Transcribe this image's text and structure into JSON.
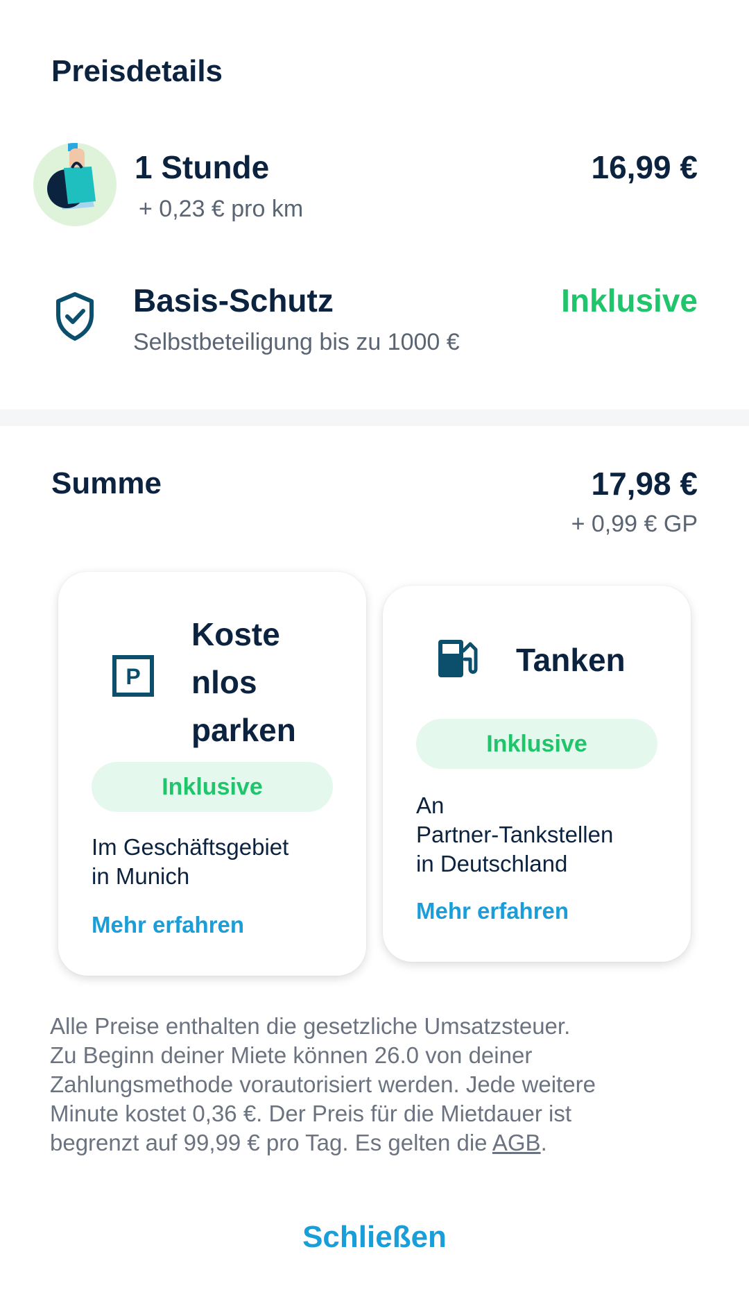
{
  "header": {
    "title": "Preisdetails"
  },
  "rental": {
    "title": "1 Stunde",
    "per_km": "+ 0,23 € pro km",
    "price": "16,99 €",
    "icon": "shopping-bag-icon"
  },
  "protection": {
    "title": "Basis-Schutz",
    "subtitle": "Selbstbeteiligung bis zu 1000 €",
    "price": "Inklusive",
    "icon": "shield-check-icon"
  },
  "total": {
    "label": "Summe",
    "amount": "17,98 €",
    "fee": "+ 0,99 € GP"
  },
  "cards": {
    "parking": {
      "icon": "parking-icon",
      "icon_letter": "P",
      "title_lines": [
        "Koste",
        "nlos",
        "parken"
      ],
      "badge": "Inklusive",
      "text_lines": [
        "Im Geschäftsgebiet",
        "in Munich"
      ],
      "link": "Mehr erfahren"
    },
    "fuel": {
      "icon": "fuel-pump-icon",
      "title": "Tanken",
      "badge": "Inklusive",
      "text_lines": [
        "An",
        "Partner-Tankstellen",
        "in Deutschland"
      ],
      "link": "Mehr erfahren"
    }
  },
  "footnote": {
    "lines": [
      "Alle Preise enthalten die gesetzliche Umsatzsteuer.",
      "Zu Beginn deiner Miete können 26.0 von deiner",
      "Zahlungsmethode vorautorisiert werden. Jede weitere",
      "Minute kostet 0,36 €. Der Preis für die Mietdauer ist"
    ],
    "last_line_prefix": "begrenzt auf 99,99 € pro Tag. Es gelten die ",
    "agb_link": "AGB",
    "last_line_suffix": "."
  },
  "close_button": "Schließen",
  "colors": {
    "text_dark": "#0c2340",
    "green": "#1fc46b",
    "link_blue": "#1a9ed9",
    "pill_bg": "#e5f8ee",
    "icon_teal": "#0b4f6c"
  }
}
